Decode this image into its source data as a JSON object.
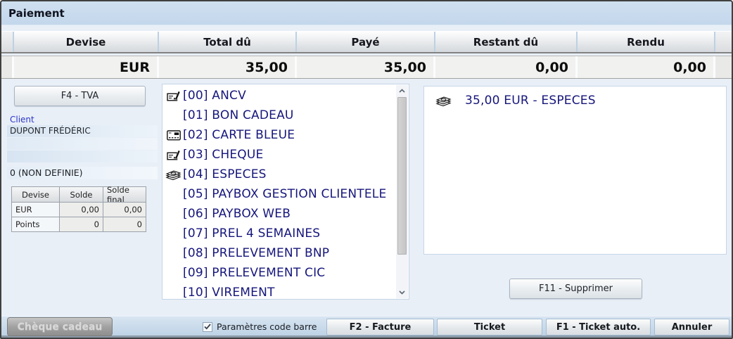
{
  "window": {
    "title": "Paiement"
  },
  "summary_table": {
    "columns": [
      "Devise",
      "Total dû",
      "Payé",
      "Restant dû",
      "Rendu"
    ],
    "row": [
      "EUR",
      "35,00",
      "35,00",
      "0,00",
      "0,00"
    ]
  },
  "left_panel": {
    "tva_button": "F4 - TVA",
    "client_label": "Client",
    "client_rows": [
      "DUPONT FRÉDÉRIC",
      "",
      ""
    ],
    "client_note": "0 (NON DEFINIE)",
    "balance_table": {
      "columns": [
        "Devise",
        "Solde",
        "Solde final"
      ],
      "rows": [
        {
          "label": "EUR",
          "values": [
            "0,00",
            "0,00"
          ]
        },
        {
          "label": "Points",
          "values": [
            "0",
            "0"
          ]
        }
      ]
    }
  },
  "payment_methods": [
    {
      "label": "[00] ANCV",
      "icon": "cheque-icon"
    },
    {
      "label": "[01] BON CADEAU",
      "icon": ""
    },
    {
      "label": "[02] CARTE BLEUE",
      "icon": "card-icon"
    },
    {
      "label": "[03] CHEQUE",
      "icon": "cheque-icon"
    },
    {
      "label": "[04] ESPECES",
      "icon": "cash-icon"
    },
    {
      "label": "[05] PAYBOX GESTION CLIENTELE",
      "icon": ""
    },
    {
      "label": "[06] PAYBOX WEB",
      "icon": ""
    },
    {
      "label": "[07] PREL 4 SEMAINES",
      "icon": ""
    },
    {
      "label": "[08] PRELEVEMENT BNP",
      "icon": ""
    },
    {
      "label": "[09] PRELEVEMENT CIC",
      "icon": ""
    },
    {
      "label": "[10] VIREMENT",
      "icon": ""
    }
  ],
  "selected_payments": {
    "entries": [
      {
        "label": "35,00 EUR - ESPECES",
        "icon": "cash-icon"
      }
    ],
    "delete_button": "F11 - Supprimer"
  },
  "bottom_bar": {
    "gift_cheque_button": "Chèque cadeau",
    "barcode_checkbox_label": "Paramètres code barre",
    "barcode_checkbox_checked": true,
    "invoice_button": "F2 - Facture",
    "ticket_button": "Ticket",
    "auto_ticket_button": "F1 - Ticket auto.",
    "cancel_button": "Annuler"
  },
  "colors": {
    "titlebar": "#c8dbee",
    "window_bg": "#e9eff7",
    "list_text": "#16167c",
    "bottombar": "#c6d9ea"
  }
}
